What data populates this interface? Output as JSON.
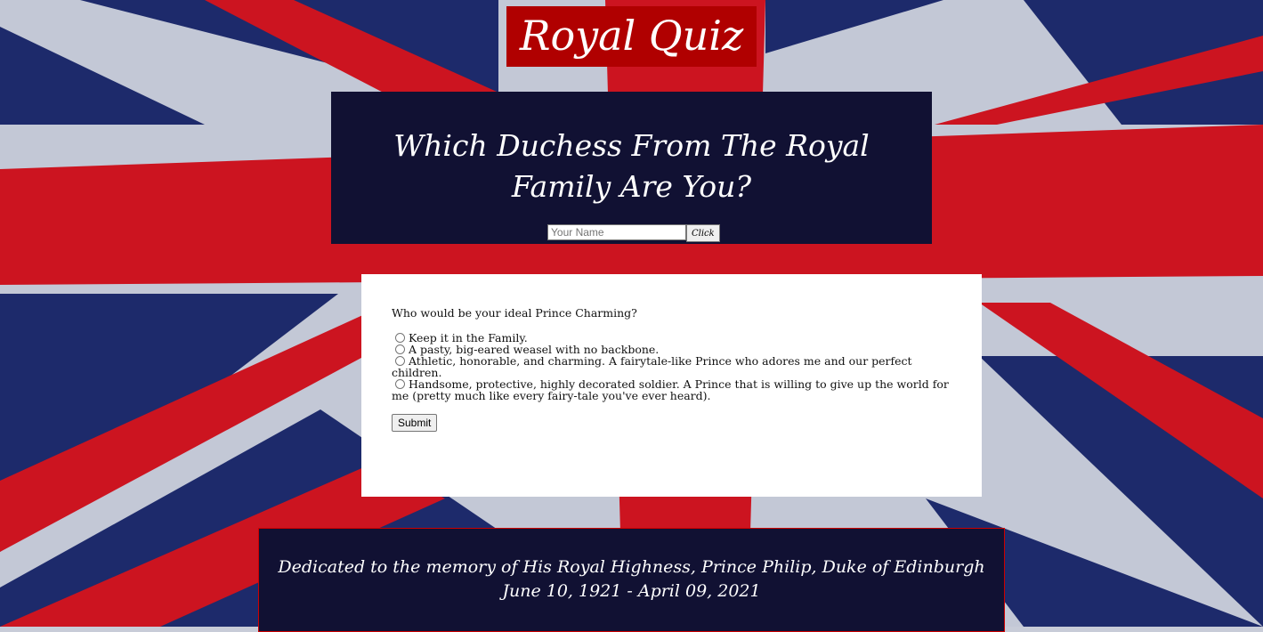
{
  "logo": {
    "text": "Royal Quiz"
  },
  "hero": {
    "title": "Which Duchess From The Royal Family Are You?",
    "name_placeholder": "Your Name",
    "name_value": "",
    "click_label": "Click"
  },
  "quiz": {
    "question": "Who would be your ideal Prince Charming?",
    "options": [
      "Keep it in the Family.",
      "A pasty, big-eared weasel with no backbone.",
      "Athletic, honorable, and charming. A fairytale-like Prince who adores me and our perfect children.",
      "Handsome, protective, highly decorated soldier. A Prince that is willing to give up the world for me (pretty much like every fairy-tale you've ever heard)."
    ],
    "submit_label": "Submit"
  },
  "footer": {
    "line1": "Dedicated to the memory of His Royal Highness, Prince Philip, Duke of Edinburgh",
    "line2": "June 10, 1921 - April 09, 2021"
  },
  "colors": {
    "red": "#b00000",
    "navy": "#111133",
    "flag_blue": "#1d2a6b",
    "flag_red": "#cc1420",
    "flag_white": "#c8ccd8"
  }
}
